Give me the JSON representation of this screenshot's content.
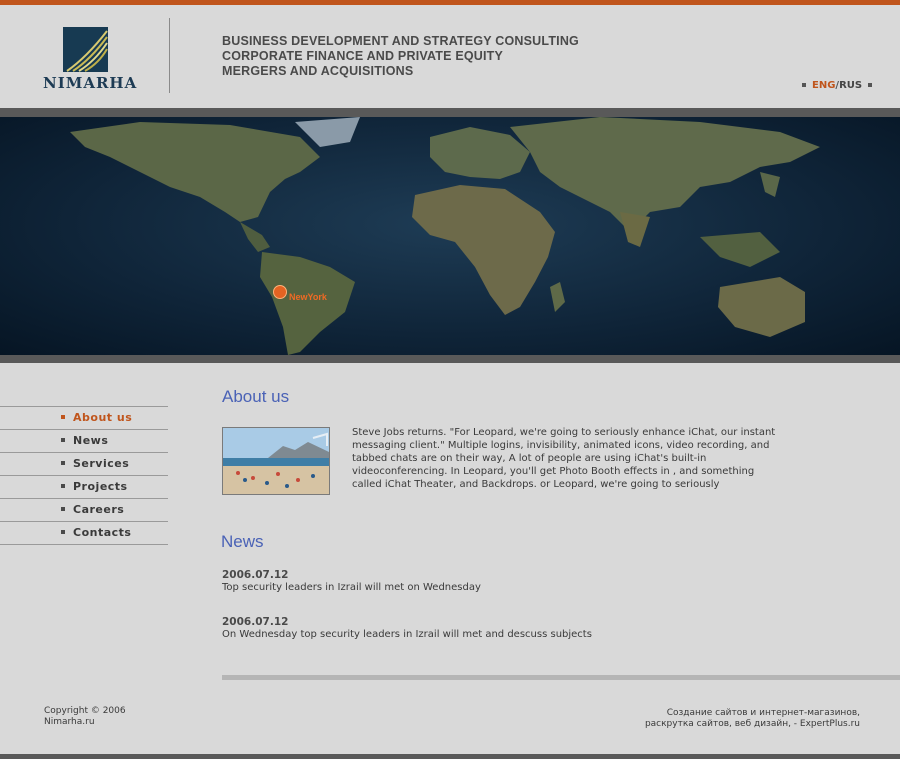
{
  "brand": {
    "name": "NIMARHA"
  },
  "header": {
    "taglines": [
      "BUSINESS DEVELOPMENT AND STRATEGY CONSULTING",
      "CORPORATE FINANCE AND PRIVATE EQUITY",
      "MERGERS AND ACQUISITIONS"
    ],
    "lang": {
      "eng": "ENG",
      "separator": "/",
      "rus": "RUS"
    }
  },
  "map": {
    "location_label": "NewYork"
  },
  "nav": {
    "items": [
      {
        "label": "About us",
        "active": true
      },
      {
        "label": "News",
        "active": false
      },
      {
        "label": "Services",
        "active": false
      },
      {
        "label": "Projects",
        "active": false
      },
      {
        "label": "Careers",
        "active": false
      },
      {
        "label": "Contacts",
        "active": false
      }
    ]
  },
  "about": {
    "title": "About us",
    "text": "Steve Jobs returns. \"For Leopard, we're going to seriously enhance iChat, our instant messaging client.\" Multiple logins, invisibility, animated icons, video recording, and tabbed chats are on their way, A lot of people are using iChat's built-in videoconferencing. In Leopard, you'll get Photo Booth effects in , and something called iChat Theater, and Backdrops. or Leopard, we're going to seriously"
  },
  "news": {
    "title": "News",
    "items": [
      {
        "date": "2006.07.12",
        "text": "Top security leaders in Izrail will met on Wednesday"
      },
      {
        "date": "2006.07.12",
        "text": "On Wednesday top security leaders in Izrail will met and descuss subjects"
      }
    ]
  },
  "footer": {
    "copyright_line1": "Copyright © 2006",
    "copyright_line2": "Nimarha.ru",
    "credits_line1": "Создание сайтов и интернет-магазинов,",
    "credits_line2": "раскрутка сайтов, веб дизайн,  - ExpertPlus.ru"
  },
  "colors": {
    "accent": "#c0551c",
    "title_blue": "#4a62b6",
    "background": "#d9d9d9",
    "dark_bar": "#595959"
  }
}
